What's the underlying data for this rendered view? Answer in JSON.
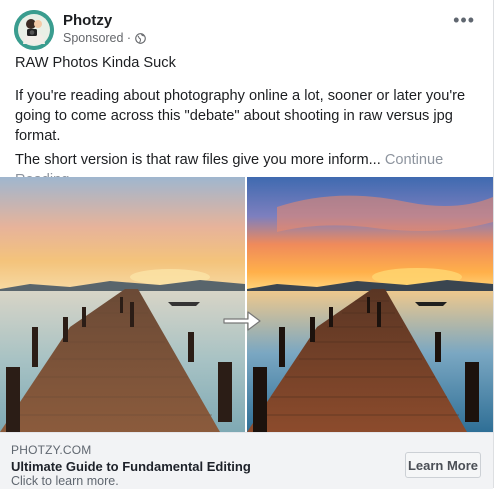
{
  "post": {
    "page_name": "Photzy",
    "sponsored": "Sponsored ·",
    "title": "RAW Photos Kinda Suck",
    "paragraph1": "If you're reading about photography online a lot, sooner or later you're going to come across this \"debate\" about shooting in raw versus jpg format.",
    "paragraph2": "The short version is that raw files give you more inform...",
    "continue_link": "Continue Reading"
  },
  "ad": {
    "domain": "PHOTZY.COM",
    "headline": "Ultimate Guide to Fundamental Editing",
    "description": "Click to learn more.",
    "cta": "Learn More"
  },
  "icons": {
    "options": "more-options-icon",
    "audience": "globe-icon",
    "compare": "arrow-right-icon"
  },
  "colors": {
    "text": "#1c1e21",
    "muted": "#65676b",
    "footer_bg": "#f2f3f5"
  }
}
